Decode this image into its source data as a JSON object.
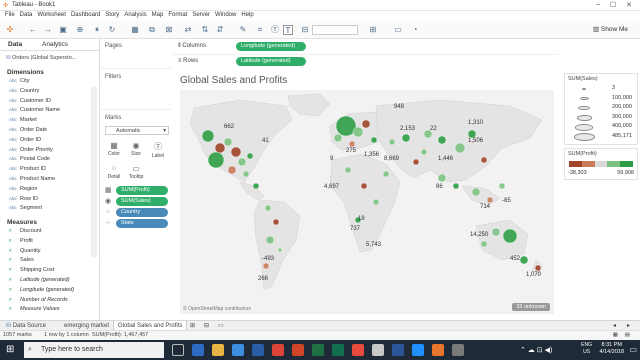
{
  "window": {
    "title": "Tableau - Book1"
  },
  "menu": [
    "File",
    "Data",
    "Worksheet",
    "Dashboard",
    "Story",
    "Analysis",
    "Map",
    "Format",
    "Server",
    "Window",
    "Help"
  ],
  "toolbar": {
    "show_me": "Show Me"
  },
  "data_pane": {
    "tab_data": "Data",
    "tab_analytics": "Analytics",
    "data_source": "Orders (Global Superstо...",
    "dimensions_header": "Dimensions",
    "dimensions": [
      "City",
      "Country",
      "Customer ID",
      "Customer Name",
      "Market",
      "Order Date",
      "Order ID",
      "Order Priority",
      "Postal Code",
      "Product ID",
      "Product Name",
      "Region",
      "Row ID",
      "Segment"
    ],
    "measures_header": "Measures",
    "measures": [
      "Discount",
      "Profit",
      "Quantity",
      "Sales",
      "Shipping Cost",
      "Latitude (generated)",
      "Longitude (generated)",
      "Number of Records",
      "Measure Values"
    ]
  },
  "cards": {
    "pages": "Pages",
    "filters": "Filters",
    "marks": "Marks",
    "mark_type": "Automatic",
    "mark_buttons": [
      "Color",
      "Size",
      "Label",
      "Detail",
      "Tooltip"
    ],
    "mark_pills": [
      "SUM(Profit)",
      "SUM(Sales)",
      "Country",
      "State"
    ]
  },
  "shelves": {
    "columns_label": "Columns",
    "columns_pill": "Longitude (generated)",
    "rows_label": "Rows",
    "rows_pill": "Latitude (generated)"
  },
  "view": {
    "title": "Global Sales and Profits",
    "attribution": "© OpenStreetMap contributors",
    "unknown_badge": "32 unknown",
    "labels": [
      "662",
      "41",
      "948",
      "2,153",
      "22",
      "1,310",
      "1,506",
      "9",
      "275",
      "1,356",
      "8,669",
      "1,446",
      "4,697",
      "86",
      "714",
      "-85",
      "18",
      "737",
      "14,250",
      "5,743",
      "452",
      "-493",
      "266",
      "1,070"
    ]
  },
  "legends": {
    "size_title": "SUM(Sales)",
    "size_values": [
      "3",
      "100,000",
      "200,000",
      "300,000",
      "400,000",
      "485,171"
    ],
    "color_title": "SUM(Profit)",
    "color_min": "-38,303",
    "color_max": "99,908",
    "color_ramp": [
      "#a0442a",
      "#c97b5c",
      "#d9d9d9",
      "#7cc382",
      "#2e9e46"
    ]
  },
  "sheet_tabs": [
    "Data Source",
    "emerging market",
    "Global Sales and Profits"
  ],
  "status": {
    "marks": "1057 marks",
    "rows": "1 row by 1 column",
    "sum": "SUM(Profit): 1,467,457"
  },
  "taskbar": {
    "search_placeholder": "Type here to search",
    "lang_top": "ENG",
    "lang_bottom": "US",
    "time": "8:31 PM",
    "date": "4/14/2018"
  }
}
